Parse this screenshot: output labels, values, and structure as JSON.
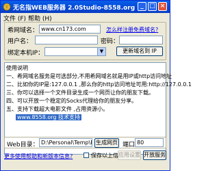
{
  "window": {
    "title": "无名指WEB服务器 2.0Studio-8558.org",
    "controls": {
      "minimize": "_",
      "maximize": "□",
      "close": "×"
    }
  },
  "menu": {
    "items": [
      "文件 (F)",
      "帮助 (H)"
    ]
  },
  "form": {
    "domain_label": "希网域名：",
    "domain_value": "www.cn173.com",
    "register_link": "怎么样注册免费域名?",
    "username_label": "用户名：",
    "username_value": "",
    "password_label": "密码：",
    "password_value": "",
    "bind_ip_label": "绑定本机IP：",
    "bind_ip_value": "",
    "update_ip_button": "更新域名到 IP"
  },
  "instructions": {
    "lines": [
      "使用说明",
      "一、希网域名服务是可选部分,不用希网域名就是用IP或http访问地址",
      "二、比如你的IP是:127.0.0.1 ,那么你的http访问地址可用:http://127.0.0.1",
      "三、你可以选择一个文件目录生成一个网页让你的朋友下载。",
      "四、可以开放一个稳定的Socks代理给你的朋友分享。",
      "五、支持下载超大电影文件 ,占用资源小。"
    ],
    "highlight": "www.8558.org 技术支持"
  },
  "bottom": {
    "web_dir_label": "Web目录：",
    "web_dir_value": "D:\\Personal\\Temp\\Rar$EX0",
    "generate_button": "生成网页",
    "port_label": "端口",
    "port_value": "80",
    "more_help_link": "更多使用帮助和新版本信息?",
    "save_checkbox_label": "保存以上信息",
    "apply_button": "应用设置",
    "start_button": "开放服务"
  },
  "colors": {
    "titlebar": "#0A5FE8",
    "face": "#ECE9D8",
    "link": "#0000EE",
    "selection": "#316AC5"
  },
  "icons": {
    "app": "server-globe-icon"
  }
}
